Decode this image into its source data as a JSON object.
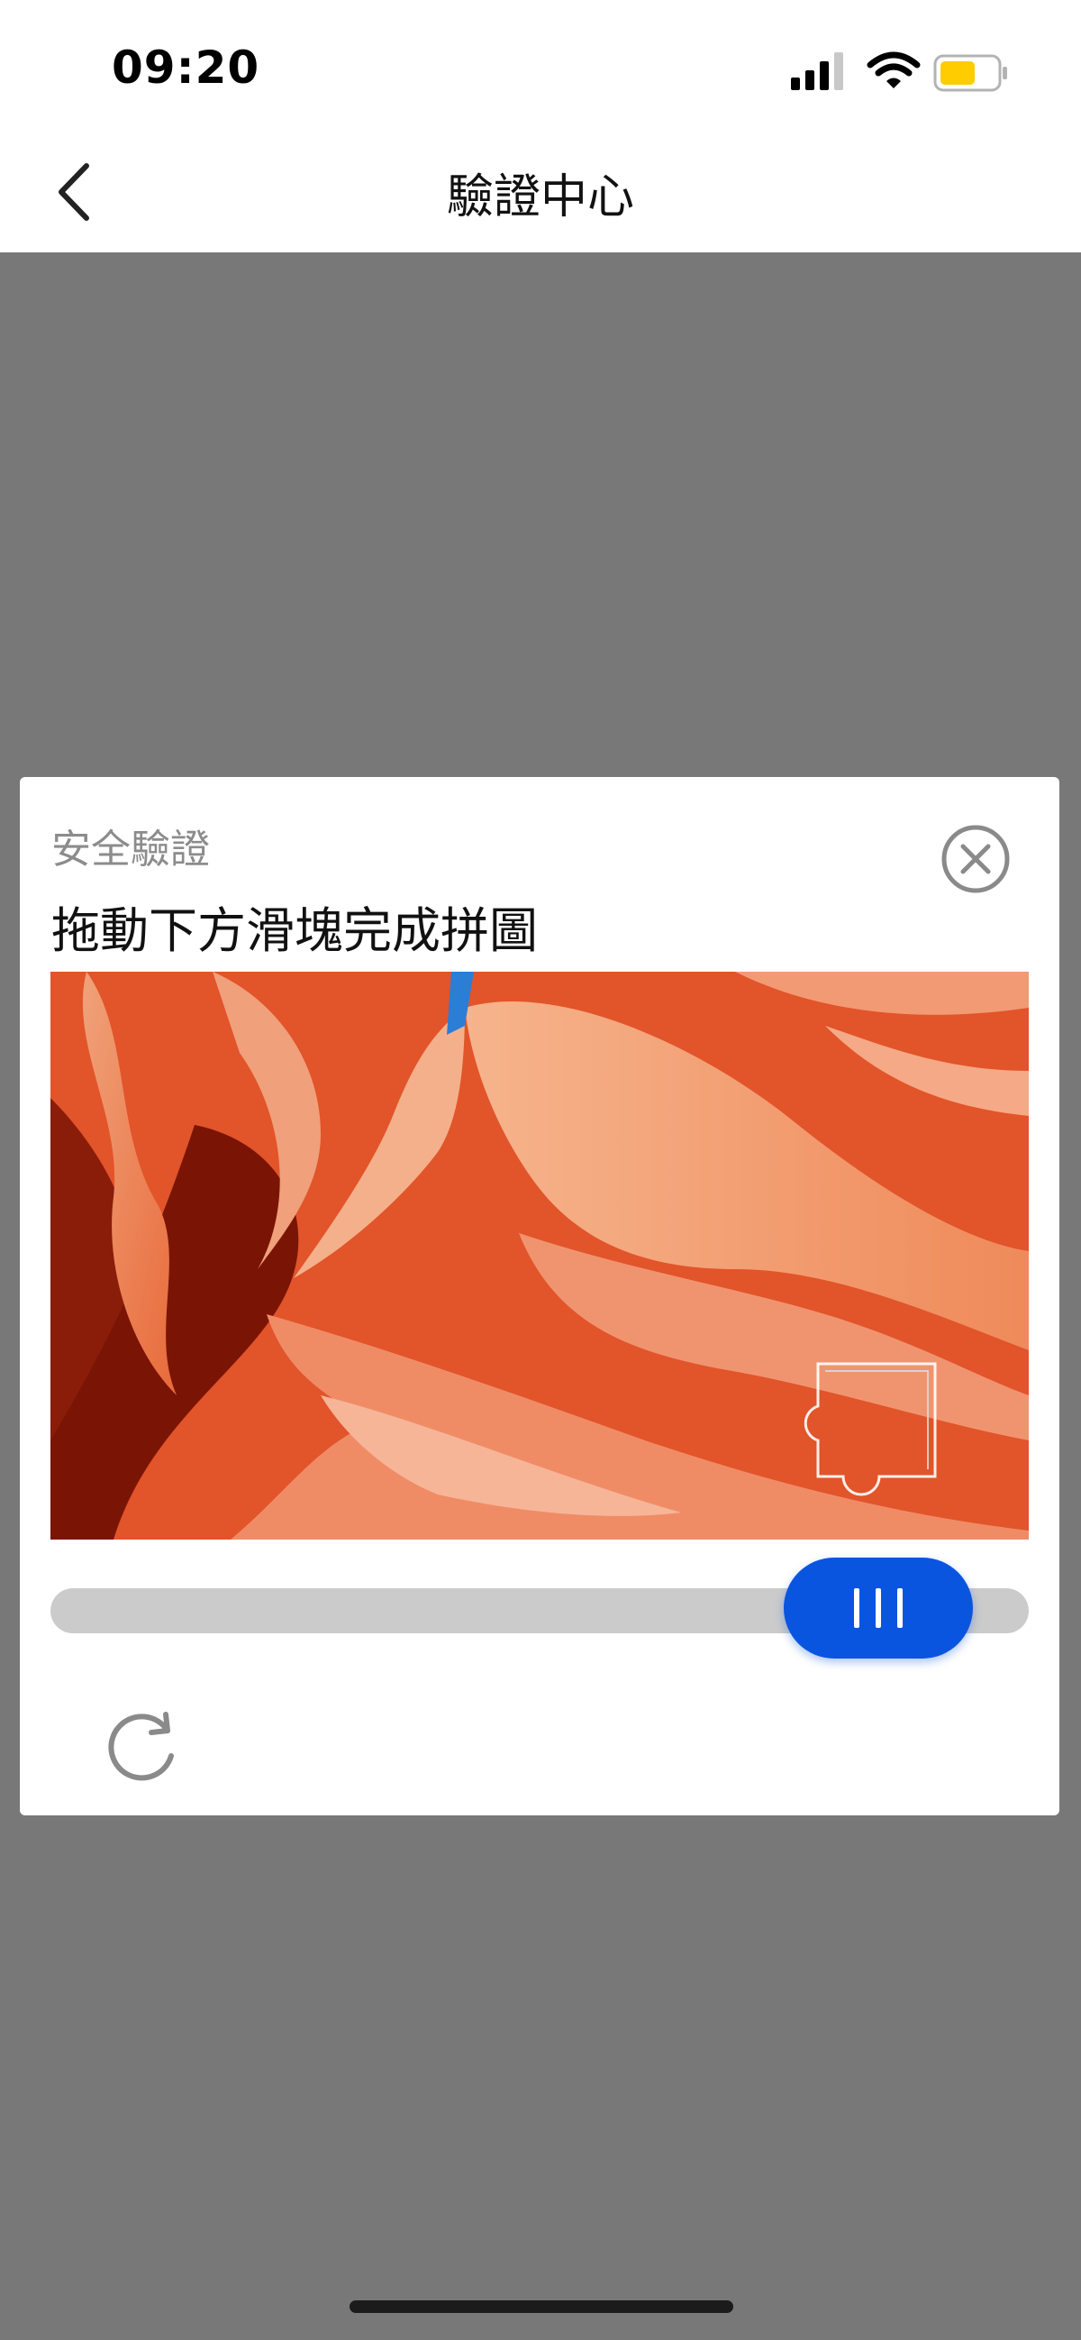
{
  "status_bar": {
    "time": "09:20",
    "icons": [
      "cellular-signal-icon",
      "wifi-icon",
      "battery-icon"
    ],
    "battery_color": "#ffcc00"
  },
  "nav": {
    "title": "驗證中心",
    "back_icon": "chevron-left-icon"
  },
  "captcha": {
    "subtitle": "安全驗證",
    "title": "拖動下方滑塊完成拼圖",
    "close_icon": "close-circle-icon",
    "image_description": "orange sandstone slot canyon",
    "slider_position_fraction": 0.84,
    "slider_icon": "grip-lines-icon",
    "refresh_icon": "refresh-icon"
  },
  "colors": {
    "overlay": "#787878",
    "accent": "#0a55e0",
    "track": "#cbcbcb"
  }
}
